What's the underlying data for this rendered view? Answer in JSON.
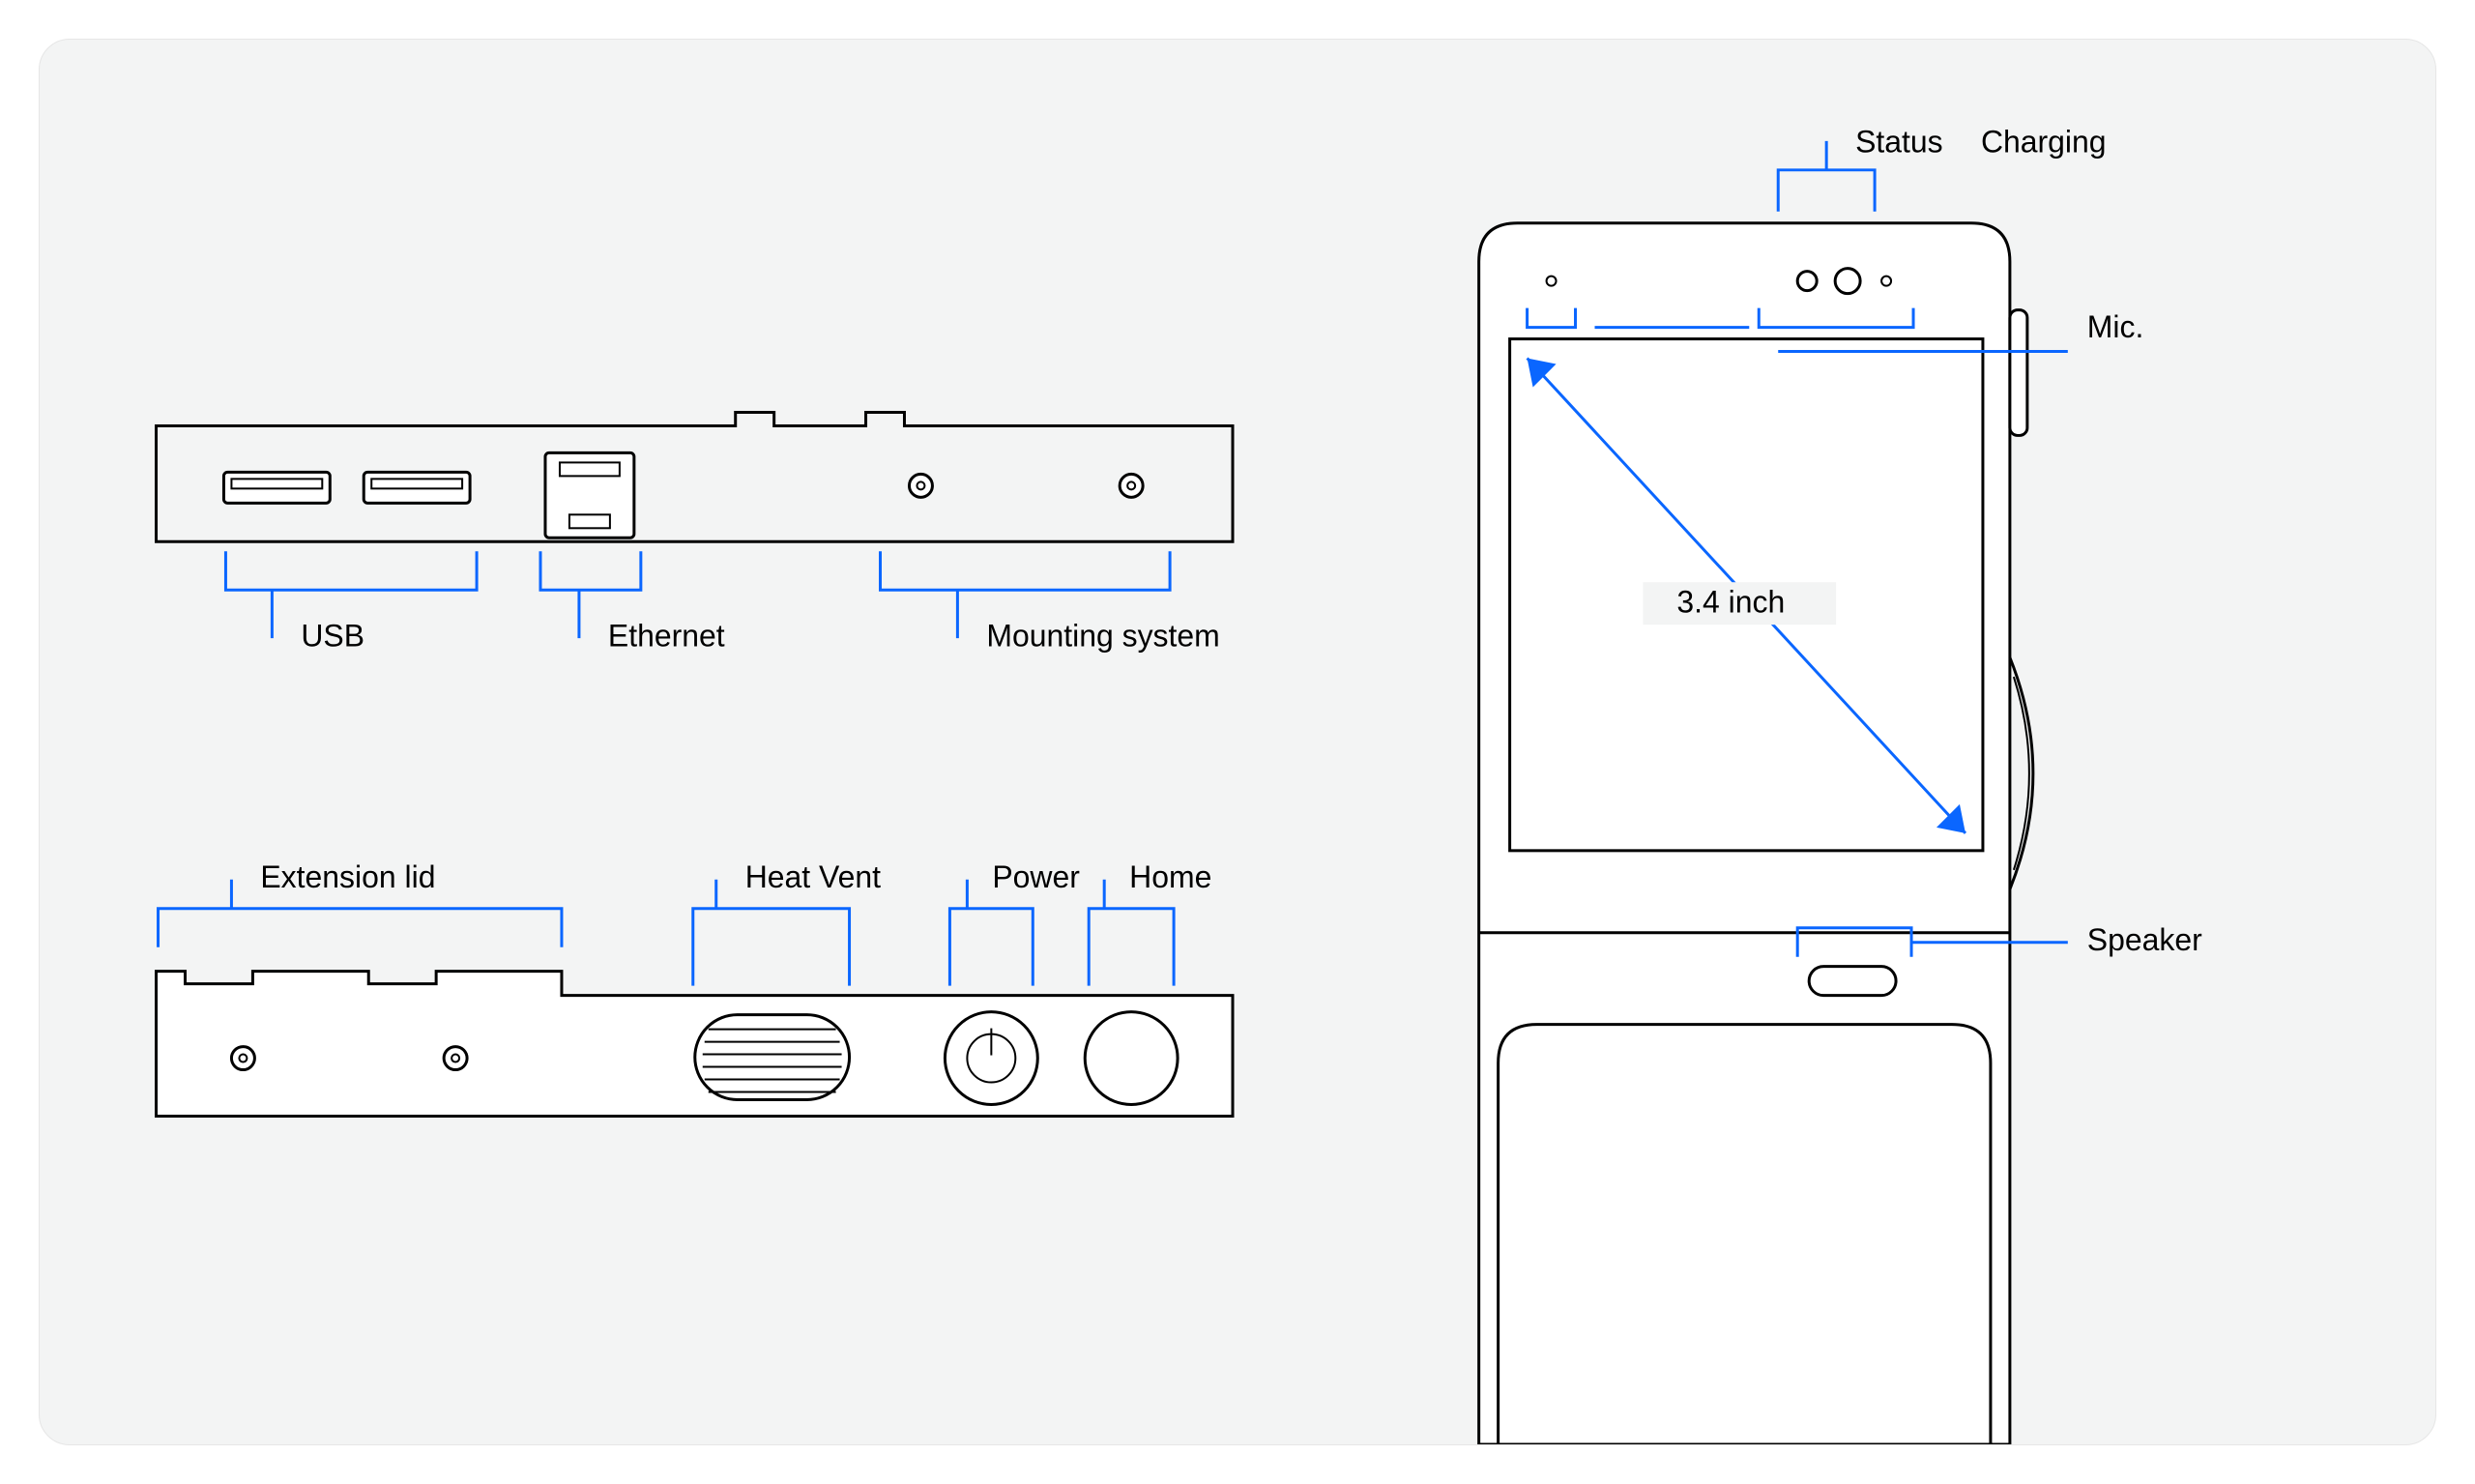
{
  "labels": {
    "usb": "USB",
    "ethernet": "Ethernet",
    "mounting": "Mounting system",
    "extension_lid": "Extension lid",
    "heat_vent": "Heat Vent",
    "power": "Power",
    "home": "Home",
    "status": "Status",
    "charging": "Charging",
    "mic": "Mic.",
    "speaker": "Speaker",
    "screen_size": "3.4 inch"
  },
  "colors": {
    "lead": "#0a66ff",
    "outline": "#010101",
    "panel_bg": "#f3f4f4"
  }
}
